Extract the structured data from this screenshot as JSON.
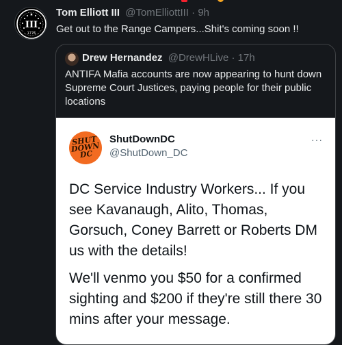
{
  "tweet": {
    "author_name": "Tom Elliott III",
    "author_handle": "@TomElliottIII",
    "separator": "·",
    "time": "9h",
    "text": "Get out to the Range Campers...Shit's coming soon !!",
    "avatar_text": "1776",
    "avatar_icon": "three-percenter-icon"
  },
  "quoted": {
    "author_name": "Drew Hernandez",
    "author_handle": "@DrewHLive",
    "separator": "·",
    "time": "17h",
    "text": "ANTIFA Mafia accounts are now appearing to hunt down Supreme Court Justices, paying people for their public locations"
  },
  "embedded": {
    "author_name": "ShutDownDC",
    "author_handle": "@ShutDown_DC",
    "avatar_text": "SHUT DOWN DC",
    "more_label": "···",
    "paragraph_1": "DC Service Industry Workers... If you see Kavanaugh, Alito, Thomas, Gorsuch, Coney Barrett or Roberts DM us with the details!",
    "paragraph_2": "We'll venmo you $50 for a confirmed sighting and $200 if they're still there 30 mins after your message."
  },
  "colors": {
    "background": "#15181c",
    "text_primary": "#e7e9ea",
    "text_secondary": "#71767b",
    "embed_avatar": "#f26b21"
  }
}
